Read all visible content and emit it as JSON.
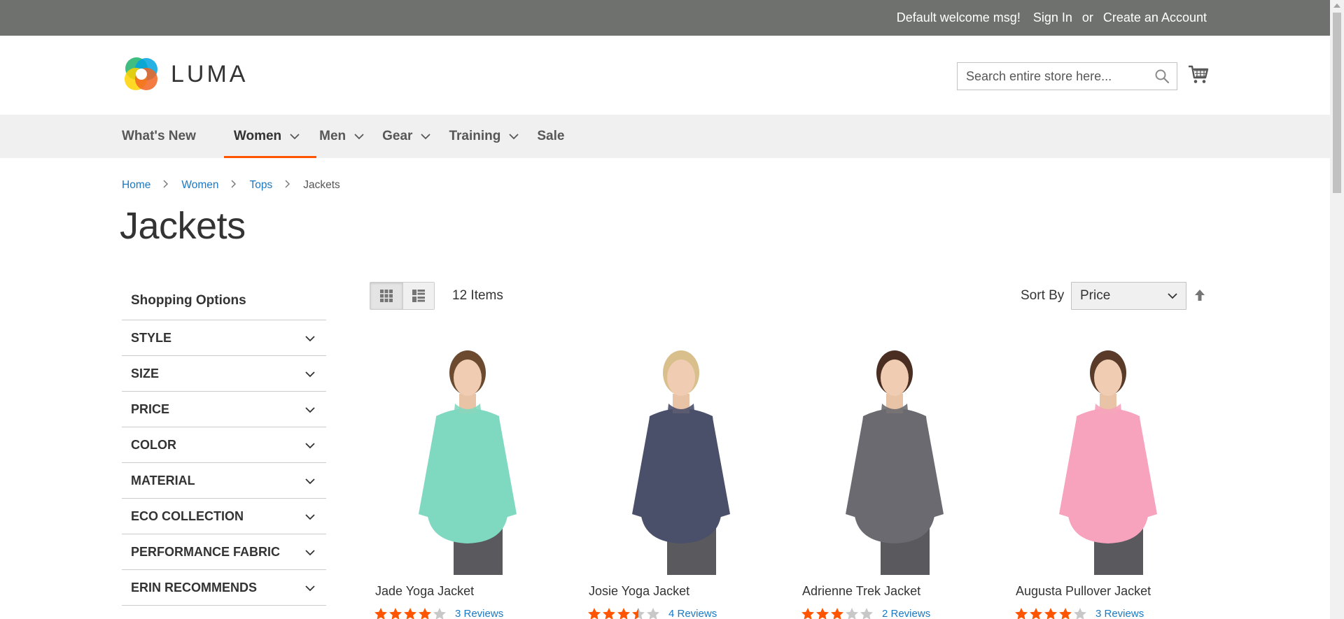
{
  "panel": {
    "welcome": "Default welcome msg!",
    "sign_in": "Sign In",
    "or": "or",
    "create_account": "Create an Account"
  },
  "header": {
    "logo_text": "LUMA",
    "search_placeholder": "Search entire store here..."
  },
  "nav": {
    "items": [
      {
        "label": "What's New",
        "dropdown": false,
        "active": false
      },
      {
        "label": "Women",
        "dropdown": true,
        "active": true
      },
      {
        "label": "Men",
        "dropdown": true,
        "active": false
      },
      {
        "label": "Gear",
        "dropdown": true,
        "active": false
      },
      {
        "label": "Training",
        "dropdown": true,
        "active": false
      },
      {
        "label": "Sale",
        "dropdown": false,
        "active": false
      }
    ]
  },
  "breadcrumbs": [
    "Home",
    "Women",
    "Tops",
    "Jackets"
  ],
  "page_title": "Jackets",
  "sidebar": {
    "title": "Shopping Options",
    "filters": [
      "STYLE",
      "SIZE",
      "PRICE",
      "COLOR",
      "MATERIAL",
      "ECO COLLECTION",
      "PERFORMANCE FABRIC",
      "ERIN RECOMMENDS"
    ]
  },
  "toolbar": {
    "amount": "12 Items",
    "sort_label": "Sort By",
    "sort_value": "Price"
  },
  "products": [
    {
      "name": "Jade Yoga Jacket",
      "rating_of_5": 4,
      "reviews": "3 Reviews",
      "color": "#7fd8c0",
      "hair": "#6b4a2f"
    },
    {
      "name": "Josie Yoga Jacket",
      "rating_of_5": 3.5,
      "reviews": "4 Reviews",
      "color": "#4a4f6a",
      "hair": "#d9bf8c"
    },
    {
      "name": "Adrienne Trek Jacket",
      "rating_of_5": 3,
      "reviews": "2 Reviews",
      "color": "#6a6a70",
      "hair": "#4a2e22"
    },
    {
      "name": "Augusta Pullover Jacket",
      "rating_of_5": 4,
      "reviews": "3 Reviews",
      "color": "#f7a3bd",
      "hair": "#5a3a28"
    }
  ],
  "colors": {
    "accent": "#ff5501",
    "link": "#1979c3",
    "panel_bg": "#6e716e",
    "nav_bg": "#f0f0f0",
    "star_on": "#ff5501",
    "star_off": "#c8c8c8"
  }
}
